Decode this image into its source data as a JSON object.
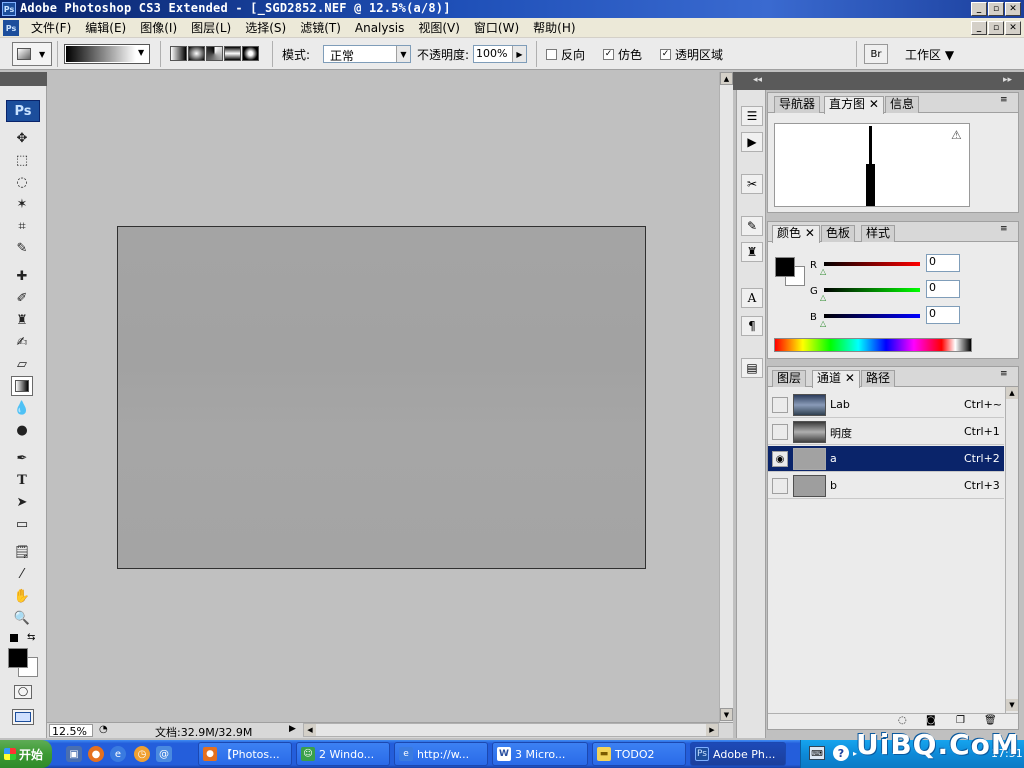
{
  "window": {
    "title": "Adobe Photoshop CS3 Extended - [_SGD2852.NEF @ 12.5%(a/8)]",
    "app_icon": "Ps"
  },
  "menu": {
    "items": [
      "文件(F)",
      "编辑(E)",
      "图像(I)",
      "图层(L)",
      "选择(S)",
      "滤镜(T)",
      "Analysis",
      "视图(V)",
      "窗口(W)",
      "帮助(H)"
    ]
  },
  "options": {
    "mode_label": "模式:",
    "mode_value": "正常",
    "opacity_label": "不透明度:",
    "opacity_value": "100%",
    "reverse_label": "反向",
    "dither_label": "仿色",
    "transparency_label": "透明区域",
    "dither_checked": "✓",
    "transparency_checked": "✓",
    "workspace_label": "工作区 ▼"
  },
  "toolbox": {
    "ps_logo": "Ps"
  },
  "status": {
    "zoom": "12.5%",
    "doc_info": "文档:32.9M/32.9M"
  },
  "panels": {
    "histogram_group": {
      "tabs": [
        "导航器",
        "直方图",
        "信息"
      ],
      "active": "直方图",
      "warning": "⚠"
    },
    "color_group": {
      "tabs": [
        "颜色",
        "色板",
        "样式"
      ],
      "active": "颜色",
      "channels": [
        {
          "label": "R",
          "value": "0"
        },
        {
          "label": "G",
          "value": "0"
        },
        {
          "label": "B",
          "value": "0"
        }
      ]
    },
    "channels_group": {
      "tabs": [
        "图层",
        "通道",
        "路径"
      ],
      "active": "通道",
      "rows": [
        {
          "name": "Lab",
          "shortcut": "Ctrl+~"
        },
        {
          "name": "明度",
          "shortcut": "Ctrl+1"
        },
        {
          "name": "a",
          "shortcut": "Ctrl+2"
        },
        {
          "name": "b",
          "shortcut": "Ctrl+3"
        }
      ]
    }
  },
  "taskbar": {
    "start_label": "开始",
    "buttons": [
      {
        "label": "【Photos...",
        "icon": "firefox-icon"
      },
      {
        "label": "2 Windo...",
        "icon": "messenger-icon"
      },
      {
        "label": "http://w...",
        "icon": "ie-icon"
      },
      {
        "label": "3 Micro...",
        "icon": "word-icon"
      },
      {
        "label": "TODO2",
        "icon": "folder-icon"
      },
      {
        "label": "Adobe Ph...",
        "icon": "photoshop-icon"
      }
    ],
    "clock": "17:51",
    "watermark": "UiBQ.CoM"
  },
  "colors": {
    "title_bar": "#0a246a",
    "selection": "#0a246a",
    "taskbar": "#245edb",
    "start": "#3c9a33"
  }
}
